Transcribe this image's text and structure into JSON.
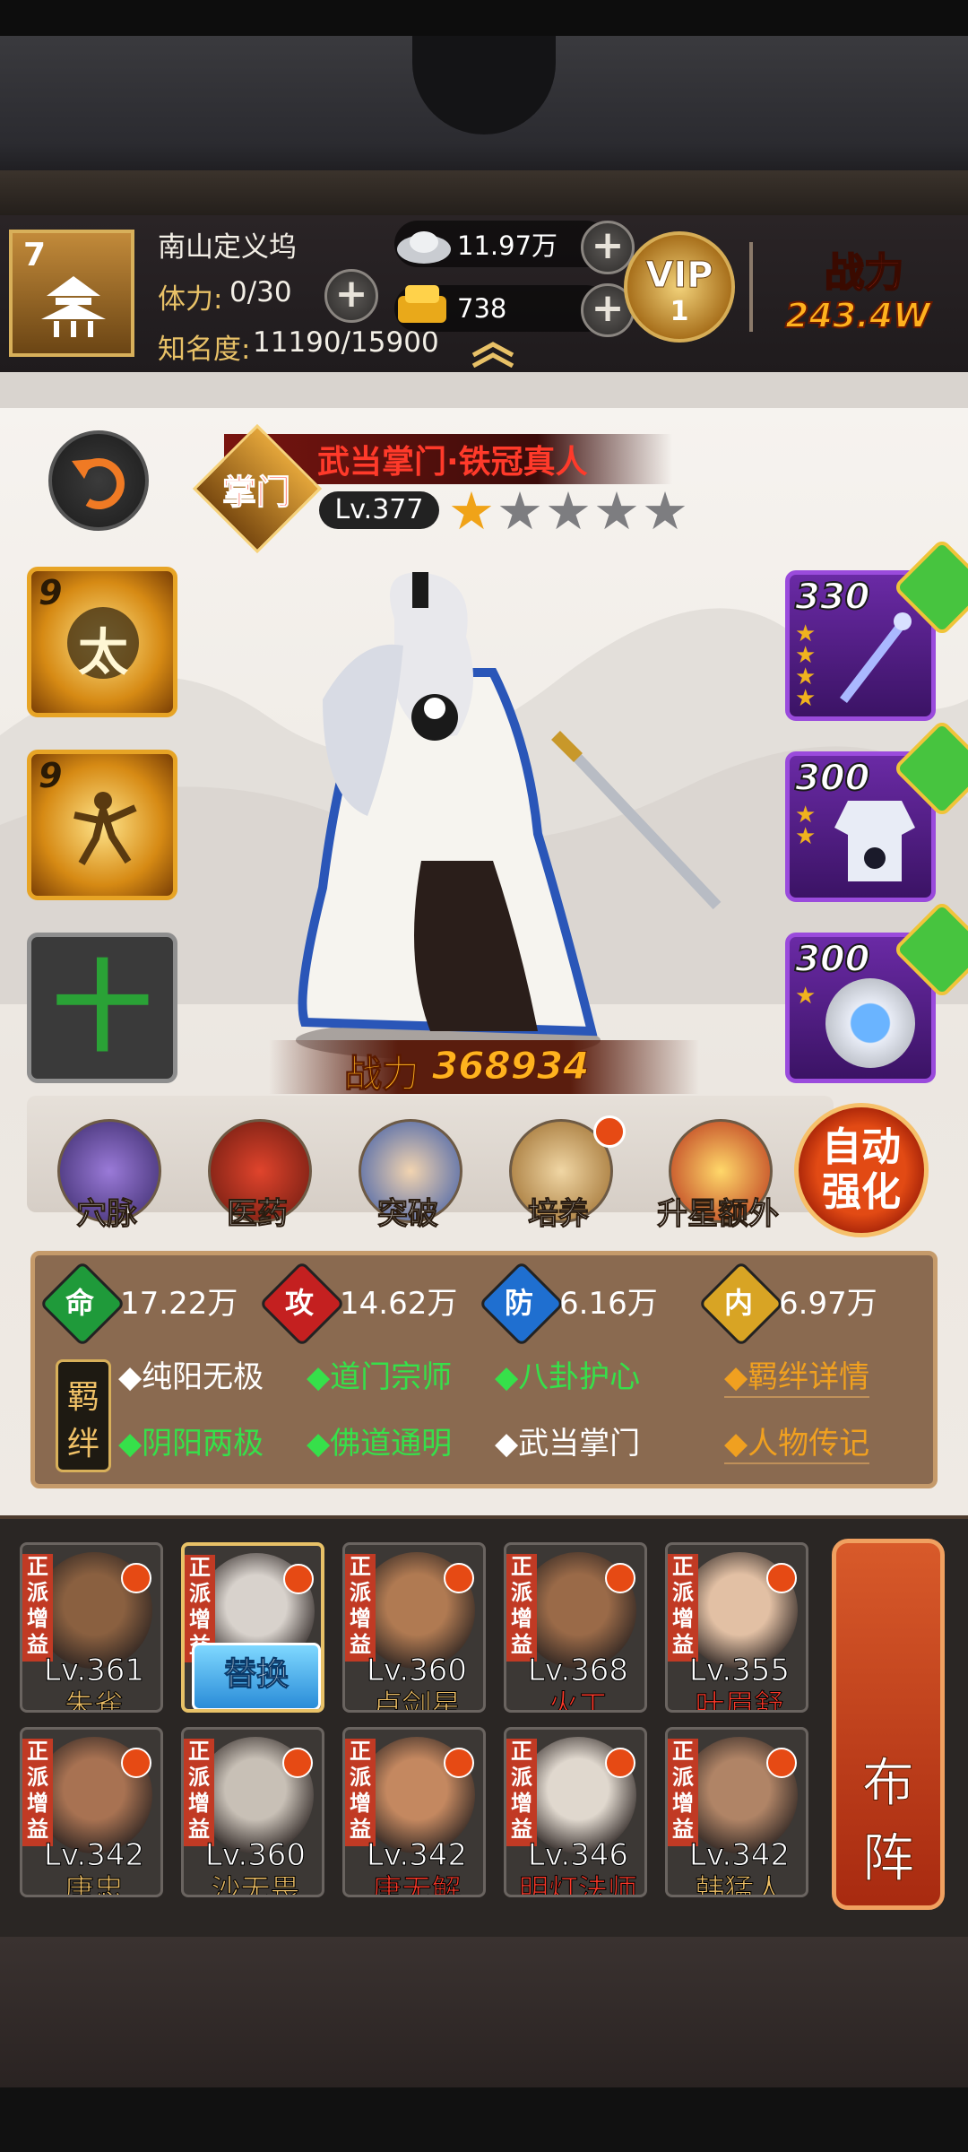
{
  "header": {
    "player_level": "7",
    "player_name": "南山定义坞",
    "stamina_label": "体力:",
    "stamina_value": "0/30",
    "fame_label": "知名度:",
    "fame_value": "11190/15900",
    "silver": "11.97万",
    "gold": "738",
    "vip_label": "VIP",
    "vip_level": "1",
    "power_label": "战力",
    "power_value": "243.4W"
  },
  "hero": {
    "title": "武当掌门·铁冠真人",
    "rank_badge": "掌门",
    "level": "Lv.377",
    "stars_filled": 1,
    "stars_total": 5,
    "power_label": "战力",
    "power_value": "368934"
  },
  "skills": [
    {
      "level": "9",
      "glyph": "太",
      "icon": "taiji-scroll-icon"
    },
    {
      "level": "9",
      "glyph": "",
      "icon": "martial-art-figure-icon"
    },
    {
      "level": "",
      "glyph": "十",
      "icon": "add-skill-icon"
    }
  ],
  "equipment": [
    {
      "level": "330",
      "stars": 4,
      "icon": "sword-icon"
    },
    {
      "level": "300",
      "stars": 2,
      "icon": "armor-icon"
    },
    {
      "level": "300",
      "stars": 1,
      "icon": "bagua-accessory-icon"
    }
  ],
  "menu": [
    {
      "label": "穴脉",
      "icon": "meridian-icon",
      "dot": false
    },
    {
      "label": "医药",
      "icon": "medicine-icon",
      "dot": false
    },
    {
      "label": "突破",
      "icon": "breakthrough-icon",
      "dot": false
    },
    {
      "label": "培养",
      "icon": "train-scroll-icon",
      "dot": true
    },
    {
      "label": "升星额外",
      "icon": "star-up-icon",
      "dot": false
    }
  ],
  "auto_btn": {
    "line1": "自动",
    "line2": "强化"
  },
  "stats": [
    {
      "label": "命",
      "value": "17.22万",
      "color": "#1f9a3a"
    },
    {
      "label": "攻",
      "value": "14.62万",
      "color": "#c42020"
    },
    {
      "label": "防",
      "value": "6.16万",
      "color": "#1f6fd0"
    },
    {
      "label": "内",
      "value": "6.97万",
      "color": "#d8a424"
    }
  ],
  "bonds_label": {
    "line1": "羁",
    "line2": "绊"
  },
  "bonds": [
    {
      "text": "◆纯阳无极",
      "color": "#ffffff"
    },
    {
      "text": "◆道门宗师",
      "color": "#36e04a"
    },
    {
      "text": "◆八卦护心",
      "color": "#36e04a"
    },
    {
      "text": "◆阴阳两极",
      "color": "#36e04a"
    },
    {
      "text": "◆佛道通明",
      "color": "#36e04a"
    },
    {
      "text": "◆武当掌门",
      "color": "#ffffff"
    }
  ],
  "bond_links": {
    "details": "◆羁绊详情",
    "bio": "◆人物传记"
  },
  "roster_tag": "正派增益",
  "roster": [
    {
      "level": "Lv.361",
      "name": "朱雀",
      "name_color": "#f0c167",
      "skin": "#8a6040"
    },
    {
      "level": "",
      "name": "",
      "name_color": "#ffffff",
      "skin": "#d8d2cc",
      "button": "替换"
    },
    {
      "level": "Lv.360",
      "name": "卢剑星",
      "name_color": "#f0c167",
      "skin": "#b07a52"
    },
    {
      "level": "Lv.368",
      "name": "火工",
      "name_color": "#ff3a2a",
      "skin": "#9a6a48"
    },
    {
      "level": "Lv.355",
      "name": "叶眉舒",
      "name_color": "#ff3a2a",
      "skin": "#e2c0a4"
    },
    {
      "level": "Lv.342",
      "name": "唐忠",
      "name_color": "#f0c167",
      "skin": "#a87252"
    },
    {
      "level": "Lv.360",
      "name": "沙无畏",
      "name_color": "#f0c167",
      "skin": "#c8c0b6"
    },
    {
      "level": "Lv.342",
      "name": "唐无解",
      "name_color": "#ff3a2a",
      "skin": "#c48860"
    },
    {
      "level": "Lv.346",
      "name": "明灯法师",
      "name_color": "#ff3a2a",
      "skin": "#e0d8ce"
    },
    {
      "level": "Lv.342",
      "name": "韩猛人",
      "name_color": "#f0c167",
      "skin": "#b08466"
    }
  ],
  "formation_btn": {
    "line1": "布",
    "line2": "阵"
  }
}
